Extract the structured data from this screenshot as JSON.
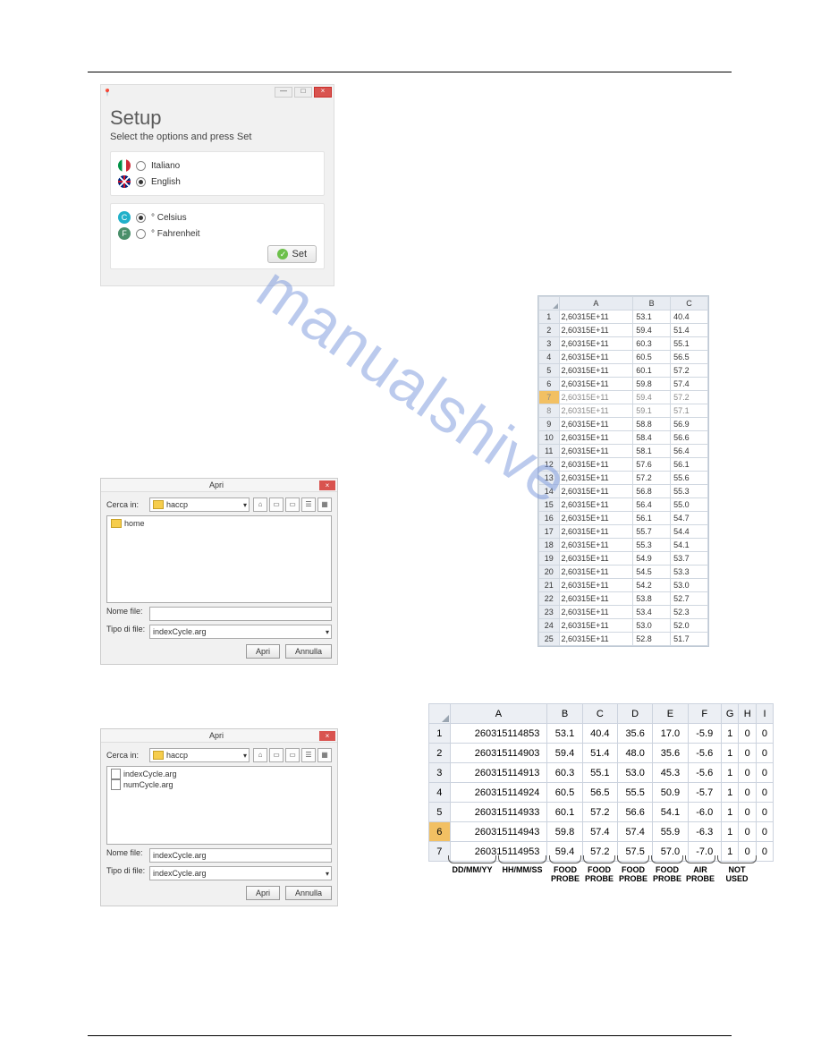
{
  "setup": {
    "title": "Setup",
    "subtitle": "Select the options and press Set",
    "lang_it": "Italiano",
    "lang_en": "English",
    "unit_c": "° Celsius",
    "unit_f": "° Fahrenheit",
    "btn": "Set",
    "pin": "📍",
    "min": "—",
    "max": "□",
    "close": "×"
  },
  "apri": {
    "title": "Apri",
    "cerca": "Cerca in:",
    "folder": "haccp",
    "home": "home",
    "nome": "Nome file:",
    "tipo": "Tipo di file:",
    "filetype": "indexCycle.arg",
    "btn_open": "Apri",
    "btn_cancel": "Annulla",
    "close": "×",
    "file1": "indexCycle.arg",
    "file2": "numCycle.arg",
    "selected": "indexCycle.arg"
  },
  "chart_data": {
    "type": "table",
    "columns": [
      "A",
      "B",
      "C"
    ],
    "rows": [
      [
        "2,60315E+11",
        "53.1",
        "40.4"
      ],
      [
        "2,60315E+11",
        "59.4",
        "51.4"
      ],
      [
        "2,60315E+11",
        "60.3",
        "55.1"
      ],
      [
        "2,60315E+11",
        "60.5",
        "56.5"
      ],
      [
        "2,60315E+11",
        "60.1",
        "57.2"
      ],
      [
        "2,60315E+11",
        "59.8",
        "57.4"
      ],
      [
        "2,60315E+11",
        "59.4",
        "57.2"
      ],
      [
        "2,60315E+11",
        "59.1",
        "57.1"
      ],
      [
        "2,60315E+11",
        "58.8",
        "56.9"
      ],
      [
        "2,60315E+11",
        "58.4",
        "56.6"
      ],
      [
        "2,60315E+11",
        "58.1",
        "56.4"
      ],
      [
        "2,60315E+11",
        "57.6",
        "56.1"
      ],
      [
        "2,60315E+11",
        "57.2",
        "55.6"
      ],
      [
        "2,60315E+11",
        "56.8",
        "55.3"
      ],
      [
        "2,60315E+11",
        "56.4",
        "55.0"
      ],
      [
        "2,60315E+11",
        "56.1",
        "54.7"
      ],
      [
        "2,60315E+11",
        "55.7",
        "54.4"
      ],
      [
        "2,60315E+11",
        "55.3",
        "54.1"
      ],
      [
        "2,60315E+11",
        "54.9",
        "53.7"
      ],
      [
        "2,60315E+11",
        "54.5",
        "53.3"
      ],
      [
        "2,60315E+11",
        "54.2",
        "53.0"
      ],
      [
        "2,60315E+11",
        "53.8",
        "52.7"
      ],
      [
        "2,60315E+11",
        "53.4",
        "52.3"
      ],
      [
        "2,60315E+11",
        "53.0",
        "52.0"
      ],
      [
        "2,60315E+11",
        "52.8",
        "51.7"
      ]
    ]
  },
  "sheet2": {
    "columns": [
      "A",
      "B",
      "C",
      "D",
      "E",
      "F",
      "G",
      "H",
      "I"
    ],
    "rows": [
      [
        "260315114853",
        "53.1",
        "40.4",
        "35.6",
        "17.0",
        "-5.9",
        "1",
        "0",
        "0"
      ],
      [
        "260315114903",
        "59.4",
        "51.4",
        "48.0",
        "35.6",
        "-5.6",
        "1",
        "0",
        "0"
      ],
      [
        "260315114913",
        "60.3",
        "55.1",
        "53.0",
        "45.3",
        "-5.6",
        "1",
        "0",
        "0"
      ],
      [
        "260315114924",
        "60.5",
        "56.5",
        "55.5",
        "50.9",
        "-5.7",
        "1",
        "0",
        "0"
      ],
      [
        "260315114933",
        "60.1",
        "57.2",
        "56.6",
        "54.1",
        "-6.0",
        "1",
        "0",
        "0"
      ],
      [
        "260315114943",
        "59.8",
        "57.4",
        "57.4",
        "55.9",
        "-6.3",
        "1",
        "0",
        "0"
      ],
      [
        "260315114953",
        "59.4",
        "57.2",
        "57.5",
        "57.0",
        "-7.0",
        "1",
        "0",
        "0"
      ]
    ],
    "labels": {
      "date": "DD/MM/YY",
      "time": "HH/MM/SS",
      "food": "FOOD\nPROBE",
      "air": "AIR\nPROBE",
      "notused": "NOT USED"
    }
  },
  "watermark": "manualshive"
}
